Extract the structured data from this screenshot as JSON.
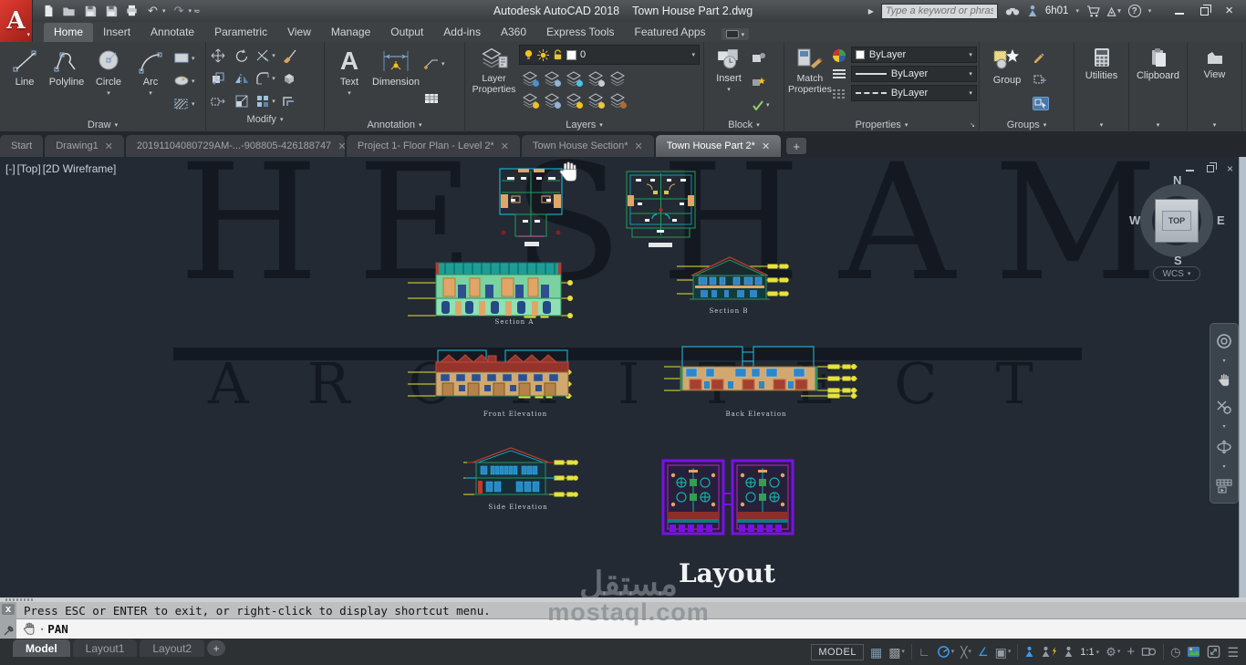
{
  "title_bar": {
    "app_title": "Autodesk AutoCAD 2018",
    "doc_title": "Town House Part 2.dwg",
    "search_placeholder": "Type a keyword or phrase",
    "username": "6h01"
  },
  "ribbon": {
    "tabs": [
      "Home",
      "Insert",
      "Annotate",
      "Parametric",
      "View",
      "Manage",
      "Output",
      "Add-ins",
      "A360",
      "Express Tools",
      "Featured Apps"
    ],
    "active_tab": "Home",
    "panel_labels": {
      "draw": "Draw",
      "modify": "Modify",
      "annotation": "Annotation",
      "layers": "Layers",
      "block": "Block",
      "properties": "Properties",
      "groups": "Groups",
      "utilities": "Utilities",
      "clipboard": "Clipboard",
      "view": "View"
    },
    "draw": {
      "line": "Line",
      "polyline": "Polyline",
      "circle": "Circle",
      "arc": "Arc"
    },
    "annotation": {
      "text": "Text",
      "dimension": "Dimension"
    },
    "layers": {
      "layer_properties": "Layer Properties",
      "current_layer": "0"
    },
    "block": {
      "insert": "Insert"
    },
    "properties": {
      "match_properties": "Match Properties",
      "color": "ByLayer",
      "lineweight": "ByLayer",
      "linetype": "ByLayer"
    },
    "groups": {
      "group": "Group"
    }
  },
  "file_tabs": [
    {
      "label": "Start",
      "active": false
    },
    {
      "label": "Drawing1",
      "active": false
    },
    {
      "label": "20191104080729AM-...-908805-426188747",
      "active": false
    },
    {
      "label": "Project 1- Floor Plan - Level 2*",
      "active": false
    },
    {
      "label": "Town House Section*",
      "active": false
    },
    {
      "label": "Town House Part 2*",
      "active": true
    }
  ],
  "viewport": {
    "controls": [
      "[-]",
      "[Top]",
      "[2D Wireframe]"
    ],
    "viewcube": {
      "n": "N",
      "s": "S",
      "e": "E",
      "w": "W",
      "top": "TOP",
      "wcs": "WCS"
    }
  },
  "watermark": {
    "brand_line1": "HESHAM",
    "brand_line2": "ARCHITECT",
    "site_arabic": "مستقل",
    "site_domain": "mostaql.com"
  },
  "drawings": {
    "section_a": "Section A",
    "section_b": "Section B",
    "front_elevation": "Front  Elevation",
    "back_elevation": "Back Elevation",
    "side_elevation": "Side  Elevation",
    "layout": "Layout"
  },
  "command_line": {
    "message": "Press ESC or ENTER to exit, or right-click to display shortcut menu.",
    "command": "PAN"
  },
  "status_bar": {
    "layout_tabs": [
      "Model",
      "Layout1",
      "Layout2"
    ],
    "model": "MODEL",
    "scale": "1:1"
  },
  "colors": {
    "accent_blue": "#3d9be9",
    "canvas_bg": "#232a33",
    "dim_yellow": "#e6e23a",
    "cad_cyan": "#18c4e8",
    "cad_green": "#1f9e5a",
    "cad_orange": "#e2a568",
    "cad_purple": "#7a10e8"
  }
}
